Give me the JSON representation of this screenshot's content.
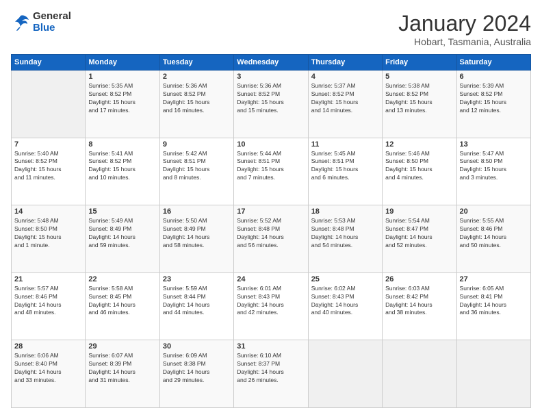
{
  "header": {
    "logo_line1": "General",
    "logo_line2": "Blue",
    "main_title": "January 2024",
    "subtitle": "Hobart, Tasmania, Australia"
  },
  "days_of_week": [
    "Sunday",
    "Monday",
    "Tuesday",
    "Wednesday",
    "Thursday",
    "Friday",
    "Saturday"
  ],
  "weeks": [
    [
      {
        "day": "",
        "info": ""
      },
      {
        "day": "1",
        "info": "Sunrise: 5:35 AM\nSunset: 8:52 PM\nDaylight: 15 hours\nand 17 minutes."
      },
      {
        "day": "2",
        "info": "Sunrise: 5:36 AM\nSunset: 8:52 PM\nDaylight: 15 hours\nand 16 minutes."
      },
      {
        "day": "3",
        "info": "Sunrise: 5:36 AM\nSunset: 8:52 PM\nDaylight: 15 hours\nand 15 minutes."
      },
      {
        "day": "4",
        "info": "Sunrise: 5:37 AM\nSunset: 8:52 PM\nDaylight: 15 hours\nand 14 minutes."
      },
      {
        "day": "5",
        "info": "Sunrise: 5:38 AM\nSunset: 8:52 PM\nDaylight: 15 hours\nand 13 minutes."
      },
      {
        "day": "6",
        "info": "Sunrise: 5:39 AM\nSunset: 8:52 PM\nDaylight: 15 hours\nand 12 minutes."
      }
    ],
    [
      {
        "day": "7",
        "info": "Sunrise: 5:40 AM\nSunset: 8:52 PM\nDaylight: 15 hours\nand 11 minutes."
      },
      {
        "day": "8",
        "info": "Sunrise: 5:41 AM\nSunset: 8:52 PM\nDaylight: 15 hours\nand 10 minutes."
      },
      {
        "day": "9",
        "info": "Sunrise: 5:42 AM\nSunset: 8:51 PM\nDaylight: 15 hours\nand 8 minutes."
      },
      {
        "day": "10",
        "info": "Sunrise: 5:44 AM\nSunset: 8:51 PM\nDaylight: 15 hours\nand 7 minutes."
      },
      {
        "day": "11",
        "info": "Sunrise: 5:45 AM\nSunset: 8:51 PM\nDaylight: 15 hours\nand 6 minutes."
      },
      {
        "day": "12",
        "info": "Sunrise: 5:46 AM\nSunset: 8:50 PM\nDaylight: 15 hours\nand 4 minutes."
      },
      {
        "day": "13",
        "info": "Sunrise: 5:47 AM\nSunset: 8:50 PM\nDaylight: 15 hours\nand 3 minutes."
      }
    ],
    [
      {
        "day": "14",
        "info": "Sunrise: 5:48 AM\nSunset: 8:50 PM\nDaylight: 15 hours\nand 1 minute."
      },
      {
        "day": "15",
        "info": "Sunrise: 5:49 AM\nSunset: 8:49 PM\nDaylight: 14 hours\nand 59 minutes."
      },
      {
        "day": "16",
        "info": "Sunrise: 5:50 AM\nSunset: 8:49 PM\nDaylight: 14 hours\nand 58 minutes."
      },
      {
        "day": "17",
        "info": "Sunrise: 5:52 AM\nSunset: 8:48 PM\nDaylight: 14 hours\nand 56 minutes."
      },
      {
        "day": "18",
        "info": "Sunrise: 5:53 AM\nSunset: 8:48 PM\nDaylight: 14 hours\nand 54 minutes."
      },
      {
        "day": "19",
        "info": "Sunrise: 5:54 AM\nSunset: 8:47 PM\nDaylight: 14 hours\nand 52 minutes."
      },
      {
        "day": "20",
        "info": "Sunrise: 5:55 AM\nSunset: 8:46 PM\nDaylight: 14 hours\nand 50 minutes."
      }
    ],
    [
      {
        "day": "21",
        "info": "Sunrise: 5:57 AM\nSunset: 8:46 PM\nDaylight: 14 hours\nand 48 minutes."
      },
      {
        "day": "22",
        "info": "Sunrise: 5:58 AM\nSunset: 8:45 PM\nDaylight: 14 hours\nand 46 minutes."
      },
      {
        "day": "23",
        "info": "Sunrise: 5:59 AM\nSunset: 8:44 PM\nDaylight: 14 hours\nand 44 minutes."
      },
      {
        "day": "24",
        "info": "Sunrise: 6:01 AM\nSunset: 8:43 PM\nDaylight: 14 hours\nand 42 minutes."
      },
      {
        "day": "25",
        "info": "Sunrise: 6:02 AM\nSunset: 8:43 PM\nDaylight: 14 hours\nand 40 minutes."
      },
      {
        "day": "26",
        "info": "Sunrise: 6:03 AM\nSunset: 8:42 PM\nDaylight: 14 hours\nand 38 minutes."
      },
      {
        "day": "27",
        "info": "Sunrise: 6:05 AM\nSunset: 8:41 PM\nDaylight: 14 hours\nand 36 minutes."
      }
    ],
    [
      {
        "day": "28",
        "info": "Sunrise: 6:06 AM\nSunset: 8:40 PM\nDaylight: 14 hours\nand 33 minutes."
      },
      {
        "day": "29",
        "info": "Sunrise: 6:07 AM\nSunset: 8:39 PM\nDaylight: 14 hours\nand 31 minutes."
      },
      {
        "day": "30",
        "info": "Sunrise: 6:09 AM\nSunset: 8:38 PM\nDaylight: 14 hours\nand 29 minutes."
      },
      {
        "day": "31",
        "info": "Sunrise: 6:10 AM\nSunset: 8:37 PM\nDaylight: 14 hours\nand 26 minutes."
      },
      {
        "day": "",
        "info": ""
      },
      {
        "day": "",
        "info": ""
      },
      {
        "day": "",
        "info": ""
      }
    ]
  ]
}
